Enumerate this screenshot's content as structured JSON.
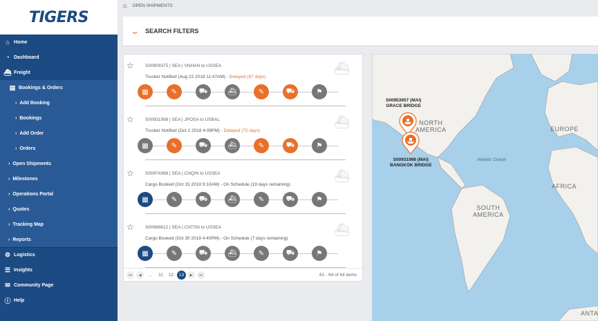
{
  "logo": {
    "text": "TIGERS"
  },
  "sidebar": {
    "items": [
      {
        "label": "Home",
        "icon": "home-icon"
      },
      {
        "label": "Dashboard",
        "icon": "dashboard-icon"
      },
      {
        "label": "Freight",
        "icon": "freight-icon"
      },
      {
        "label": "Bookings & Orders",
        "icon": "book-icon"
      },
      {
        "label": "Add Booking"
      },
      {
        "label": "Bookings"
      },
      {
        "label": "Add Order"
      },
      {
        "label": "Orders"
      },
      {
        "label": "Open Shipments"
      },
      {
        "label": "Milestones"
      },
      {
        "label": "Operations Portal"
      },
      {
        "label": "Quotes"
      },
      {
        "label": "Tracking Map"
      },
      {
        "label": "Reports"
      },
      {
        "label": "Logistics",
        "icon": "logistics-icon"
      },
      {
        "label": "Insights",
        "icon": "list-icon"
      },
      {
        "label": "Community Page",
        "icon": "chat-icon"
      },
      {
        "label": "Help",
        "icon": "info-icon"
      }
    ]
  },
  "breadcrumb": {
    "label": "OPEN SHIPMENTS"
  },
  "filters": {
    "label": "SEARCH FILTERS"
  },
  "shipments": [
    {
      "title": "S00909375 | SEA | VNHAN to USSEA",
      "status": "Trucker Notified (Aug 22 2018 11:47AM)",
      "note": " - Delayed (87 days)",
      "note_class": "warn"
    },
    {
      "title": "S00931998 | SEA | JPOSA to USBAL",
      "status": "Trucker Notified (Oct 2 2018 4:09PM)",
      "note": " - Delayed (72 days)",
      "note_class": "warn"
    },
    {
      "title": "S00974368 | SEA | CNQIN to USSEA",
      "status": "Cargo Booked (Oct 15 2018 9:10AM)",
      "note": " - On Schedule (19 days remaining)",
      "note_class": ""
    },
    {
      "title": "S00988612 | SEA | CNTSN to USSEA",
      "status": "Cargo Booked (Oct 30 2018 4:40PM)",
      "note": " - On Schedule (7 days remaining)",
      "note_class": ""
    }
  ],
  "pager": {
    "ellipsis": "...",
    "pages": [
      "11",
      "12",
      "13"
    ],
    "active": "13",
    "info": "61 - 64 of 64 items"
  },
  "map": {
    "pin1": {
      "line1": "S00953957 (MAI)",
      "line2": "GRACE BRIDGE"
    },
    "pin2": {
      "line1": "S00931998 (MAI)",
      "line2": "BANGKOK BRIDGE"
    },
    "north_america": [
      "NORTH",
      "AMERICA"
    ],
    "south_america": [
      "SOUTH",
      "AMERICA"
    ],
    "europe": "EUROPE",
    "africa": "AFRICA",
    "antarctica": "ANTA",
    "ocean": "Atlantic Ocean"
  },
  "colors": {
    "brand": "#1c4a82",
    "accent": "#e8702a",
    "inactive": "#777777"
  }
}
